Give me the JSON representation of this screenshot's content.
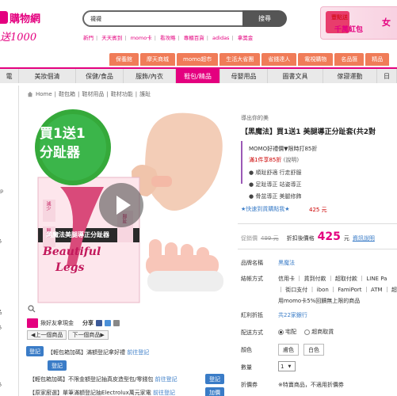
{
  "header": {
    "logo_text": "購物網",
    "logo_sub": "送1000",
    "search_value": "襪襪",
    "search_button": "搜尋",
    "quicklinks": [
      "新門",
      "天天賓到",
      "momo卡",
      "看攻略",
      "專櫃百貨",
      "adidas",
      "拿獎金"
    ],
    "banner_t1": "豐點送",
    "banner_t2": "千萬紅包",
    "banner_t3": "女"
  },
  "upper_nav": [
    "保養館",
    "摩天商城",
    "momo超市",
    "生活大省團",
    "省錢達人",
    "電視購物",
    "名品匯",
    "精品"
  ],
  "main_nav": [
    {
      "label": "電",
      "active": false
    },
    {
      "label": "美妝個清",
      "active": false
    },
    {
      "label": "保健/食品",
      "active": false
    },
    {
      "label": "服飾/內衣",
      "active": false
    },
    {
      "label": "鞋包/精品",
      "active": true
    },
    {
      "label": "母嬰用品",
      "active": false
    },
    {
      "label": "圖書文具",
      "active": false
    },
    {
      "label": "傢寢運動",
      "active": false
    },
    {
      "label": "日",
      "active": false
    }
  ],
  "sidebar": [
    "up",
    "多",
    "品",
    "多",
    "多"
  ],
  "breadcrumb": [
    "Home",
    "鞋包箱",
    "鞋材用品",
    "鞋材功能",
    "護趾"
  ],
  "product_image": {
    "badge_line1": "買1送1",
    "badge_line2": "分趾器",
    "side_text_1": "減少",
    "side_text_2": "腳部",
    "side_text_3": "腳趾",
    "title_band": "黑魔法美腿導正分趾器",
    "beautiful": "Beautiful",
    "legs": "Legs"
  },
  "share": {
    "invite": "揪好友拿現金",
    "share_label": "分享",
    "prev": "上一個商品",
    "next": "下一個商品"
  },
  "promos": [
    {
      "btn": "登記",
      "tag": "【輕包箱加碼】",
      "text": "滿額登記拿好禮",
      "link": "前往登記"
    },
    {
      "btn": "登記",
      "tag": "",
      "text": "",
      "link": ""
    },
    {
      "btn": "登記",
      "tag": "【輕包箱加碼】",
      "text": "不限金額登記抽真皮造型包/零錢包",
      "link": "前往登記"
    },
    {
      "btn": "加價",
      "tag": "【原家廚選】",
      "text": "單筆滿額登記抽Electrolux萬元家電",
      "link": "前往登記"
    }
  ],
  "info": {
    "slogan": "導出你的美",
    "title": "【黑魔法】買1送1 美腿導正分趾套(共2對",
    "promo_line1": "MOMO好禮價▼限時打85折",
    "promo_line2": "滿1件享85折",
    "promo_note": "(說明)",
    "features": [
      "● 順趾舒適 行走舒服",
      "● 足趾導正 站姿導正",
      "● 骨盆導正 美腿修飾"
    ],
    "bk_link": "★快速到貨購點我★",
    "bk_price": "425 元",
    "orig_label": "促銷價",
    "orig_price": "499 元",
    "price_label": "折扣後價格",
    "price": "425",
    "price_unit": "元",
    "price_note": "資訊說明"
  },
  "details": {
    "brand_label": "品牌名稱",
    "brand_value": "黑魔法",
    "pay_label": "結帳方式",
    "pay_line1": "信用卡 ｜ 貨到付款 ｜ 超取付款 ｜ LINE Pa",
    "pay_line2": "｜ 街口支付 ｜ ibon ｜ FamiPort ｜ ATM ｜ 超",
    "pay_line3": "用momo卡5%回饋無上限的商品",
    "bonus_label": "紅利折抵",
    "bonus_value": "共22家銀行",
    "ship_label": "配送方式",
    "ship_opt1": "宅配",
    "ship_opt2": "超商取貨",
    "color_label": "顏色",
    "color_opt1": "膚色",
    "color_opt2": "白色",
    "qty_label": "數量",
    "qty_value": "1",
    "coupon_label": "折價券",
    "coupon_value": "※特賣商品，不適用折價券"
  },
  "colors": {
    "brand": "#e4007f",
    "nav_orange": "#f07c58",
    "link_blue": "#3a7cc7"
  }
}
